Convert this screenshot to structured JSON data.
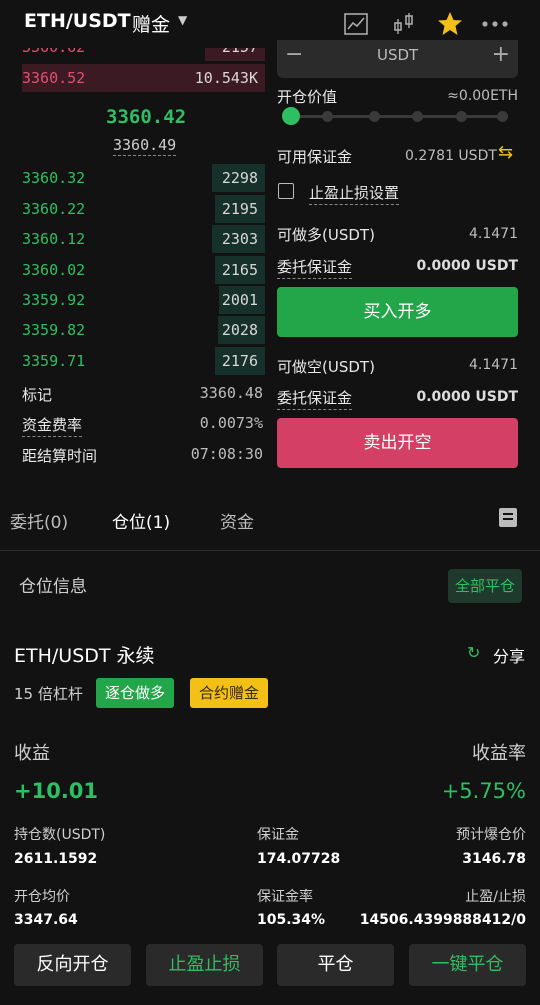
{
  "header": {
    "pair": "ETH/USDT",
    "gift": "赠金",
    "icons": [
      "chart-line-icon",
      "candlestick-icon",
      "star-icon",
      "more-icon"
    ]
  },
  "orderbook": {
    "sell_partial_top": {
      "price": "3360.62",
      "qty": "2157"
    },
    "sell": [
      {
        "price": "3360.52",
        "qty": "10.543K"
      }
    ],
    "last_price": "3360.42",
    "mark_price": "3360.49",
    "buy": [
      {
        "price": "3360.32",
        "qty": "2298"
      },
      {
        "price": "3360.22",
        "qty": "2195"
      },
      {
        "price": "3360.12",
        "qty": "2303"
      },
      {
        "price": "3360.02",
        "qty": "2165"
      },
      {
        "price": "3359.92",
        "qty": "2001"
      },
      {
        "price": "3359.82",
        "qty": "2028"
      },
      {
        "price": "3359.71",
        "qty": "2176"
      }
    ],
    "info": {
      "mark_label": "标记",
      "mark_value": "3360.48",
      "funding_label": "资金费率",
      "funding_value": "0.0073%",
      "settle_label": "距结算时间",
      "settle_value": "07:08:30"
    }
  },
  "order_panel": {
    "unit_input": "USDT",
    "open_value_label": "开仓价值",
    "open_value": "≈0.00ETH",
    "slider_percent": 0,
    "available_label": "可用保证金",
    "available_value": "0.2781 USDT",
    "tpsl_label": "止盈止损设置",
    "can_long_label": "可做多(USDT)",
    "can_long_value": "4.1471",
    "margin_label": "委托保证金",
    "margin_long_value": "0.0000 USDT",
    "buy_button": "买入开多",
    "can_short_label": "可做空(USDT)",
    "can_short_value": "4.1471",
    "margin_short_value": "0.0000 USDT",
    "sell_button": "卖出开空"
  },
  "tabs": [
    "委托(0)",
    "仓位(1)",
    "资金"
  ],
  "position": {
    "section_title": "仓位信息",
    "close_all": "全部平仓",
    "symbol": "ETH/USDT 永续",
    "share": "分享",
    "leverage": "15 倍杠杆",
    "badge_isolated": "逐仓做多",
    "badge_bonus": "合约赠金",
    "pnl_label": "收益",
    "pnl_rate_label": "收益率",
    "pnl_value": "+10.01",
    "pnl_rate_value": "+5.75%",
    "size_label": "持仓数(USDT)",
    "size_value": "2611.1592",
    "margin_label": "保证金",
    "margin_value": "174.07728",
    "liq_label": "预计爆仓价",
    "liq_value": "3146.78",
    "entry_label": "开仓均价",
    "entry_value": "3347.64",
    "margin_rate_label": "保证金率",
    "margin_rate_value": "105.34%",
    "tpsl_label": "止盈/止损",
    "tpsl_value": "14506.4399888412/0"
  },
  "bottom_buttons": [
    "反向开仓",
    "止盈止损",
    "平仓",
    "一键平仓"
  ],
  "colors": {
    "green": "#2fbf63",
    "red": "#d33f65",
    "buy_button": "#23a54a",
    "yellow": "#f2c017"
  }
}
